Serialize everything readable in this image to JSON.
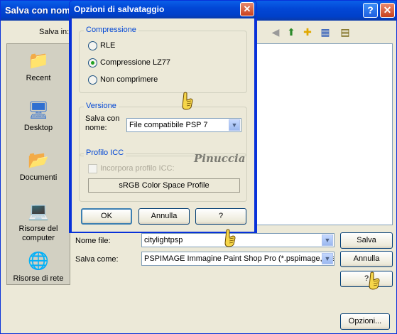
{
  "outer": {
    "title": "Salva con nome",
    "help_btn": "?",
    "close_btn": "✕",
    "save_in_label": "Salva in:",
    "places": [
      {
        "label": "Recent",
        "icon": "folder-icon"
      },
      {
        "label": "Desktop",
        "icon": "desktop-icon"
      },
      {
        "label": "Documenti",
        "icon": "documents-icon"
      },
      {
        "label": "Risorse del computer",
        "icon": "computer-icon"
      },
      {
        "label": "Risorse di rete",
        "icon": "network-icon"
      }
    ],
    "file_name_label": "Nome file:",
    "file_name_value": "citylightpsp",
    "save_as_label": "Salva come:",
    "save_as_value": "PSPIMAGE Immagine Paint Shop Pro (*.pspimage,*.psp",
    "save_button": "Salva",
    "cancel_button": "Annulla",
    "help_button": "?",
    "options_button": "Opzioni..."
  },
  "options": {
    "title": "Opzioni di salvataggio",
    "close_btn": "✕",
    "compression_legend": "Compressione",
    "compression_options": [
      {
        "label": "RLE",
        "selected": false
      },
      {
        "label": "Compressione LZ77",
        "selected": true
      },
      {
        "label": "Non comprimere",
        "selected": false
      }
    ],
    "version_legend": "Versione",
    "save_with_name_label": "Salva con nome:",
    "version_value": "File compatibile PSP 7",
    "icc_legend": "Profilo ICC",
    "embed_icc_label": "Incorpora profilo ICC:",
    "icc_profile_button": "sRGB Color Space Profile",
    "ok_button": "OK",
    "cancel_button": "Annulla",
    "help_button": "?"
  },
  "watermark": "Pinuccia"
}
